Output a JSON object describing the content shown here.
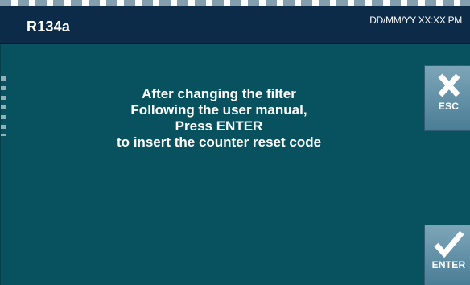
{
  "header": {
    "title": "R134a",
    "datetime": "DD/MM/YY XX:XX PM"
  },
  "message": {
    "lines": [
      "After changing the filter",
      "Following the user manual,",
      "Press ENTER",
      "to insert the counter reset code"
    ]
  },
  "buttons": {
    "esc": {
      "label": "ESC",
      "icon": "close-icon"
    },
    "enter": {
      "label": "ENTER",
      "icon": "checkmark-icon"
    }
  },
  "colors": {
    "header_bg": "#0c2b49",
    "main_bg": "#08525f",
    "button_bg": "#6a97ac",
    "text": "#ffffff"
  }
}
